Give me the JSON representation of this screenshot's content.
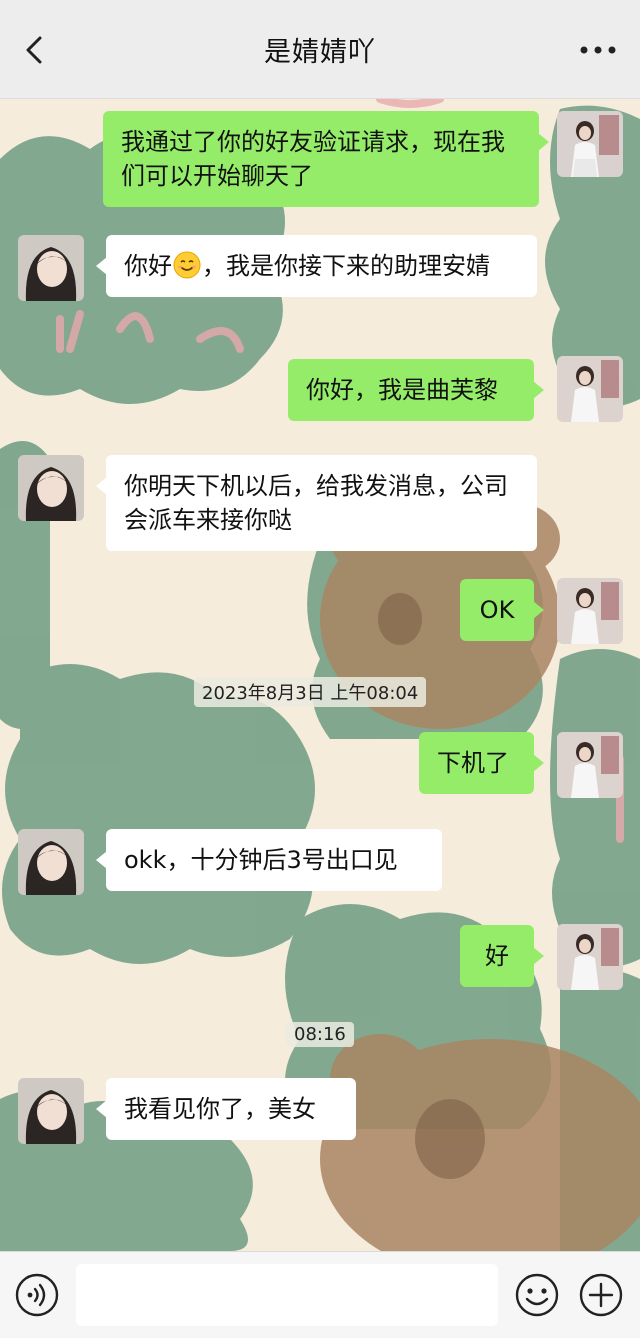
{
  "header": {
    "title": "是婧婧吖"
  },
  "messages": [
    {
      "side": "out",
      "text": "我通过了你的好友验证请求，现在我们可以开始聊天了"
    },
    {
      "side": "in",
      "text_before": "你好",
      "emoji": "smiling-face",
      "text_after": "，我是你接下来的助理安婧"
    },
    {
      "side": "out",
      "text": "你好，我是曲芙黎"
    },
    {
      "side": "in",
      "text": "你明天下机以后，给我发消息，公司会派车来接你哒"
    },
    {
      "side": "out",
      "text": "OK"
    },
    {
      "side": "out",
      "text": "下机了"
    },
    {
      "side": "in",
      "text": "okk，十分钟后3号出口见"
    },
    {
      "side": "out",
      "text": "好"
    },
    {
      "side": "in",
      "text": "我看见你了，美女"
    }
  ],
  "timestamps": [
    "2023年8月3日 上午08:04",
    "08:16"
  ],
  "input": {
    "value": "",
    "placeholder": ""
  },
  "icons": {
    "back": "chevron-left-icon",
    "more": "more-dots-icon",
    "voice": "voice-icon",
    "emoji": "smiley-icon",
    "plus": "plus-icon"
  },
  "colors": {
    "outgoing_bubble": "#95ec69",
    "incoming_bubble": "#ffffff",
    "header_bg": "#ededed"
  }
}
